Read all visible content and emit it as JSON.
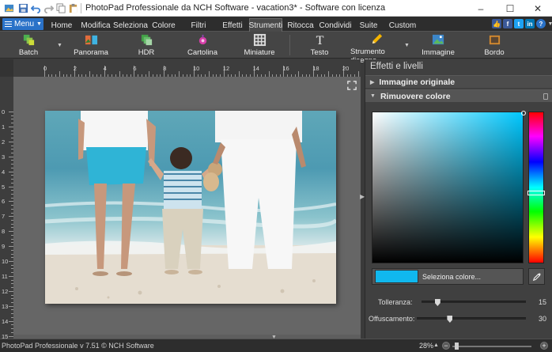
{
  "window": {
    "title": "PhotoPad Professionale da NCH Software - vacation3* - Software con licenza",
    "minimize_glyph": "–",
    "maximize_glyph": "☐",
    "close_glyph": "✕"
  },
  "menu": {
    "label": "Menu"
  },
  "tabs": [
    {
      "label": "Home"
    },
    {
      "label": "Modifica"
    },
    {
      "label": "Seleziona"
    },
    {
      "label": "Colore"
    },
    {
      "label": "Filtri"
    },
    {
      "label": "Effetti"
    },
    {
      "label": "Strumenti",
      "active": true
    },
    {
      "label": "Ritocca"
    },
    {
      "label": "Condividi"
    },
    {
      "label": "Suite"
    },
    {
      "label": "Custom"
    }
  ],
  "toolbar": {
    "batch": "Batch",
    "panorama": "Panorama",
    "hdr": "HDR",
    "cartolina": "Cartolina",
    "miniature": "Miniature",
    "testo": "Testo",
    "strumento_disegno": "Strumento disegno",
    "immagine": "Immagine",
    "bordo": "Bordo"
  },
  "ruler": {
    "top": [
      "0",
      "2",
      "4",
      "6",
      "8",
      "10",
      "12",
      "14",
      "16",
      "18",
      "20"
    ],
    "left": [
      "0",
      "1",
      "2",
      "3",
      "4",
      "5",
      "6",
      "7",
      "8",
      "9",
      "10",
      "11",
      "12",
      "13",
      "14",
      "15"
    ]
  },
  "panel": {
    "title": "Effetti e livelli",
    "section_original": "Immagine originale",
    "section_remove": "Rimuovere colore",
    "select_color_label": "Seleziona colore...",
    "selected_color": "#10b8ee",
    "tolerance_label": "Tolleranza:",
    "tolerance_value": "15",
    "tolerance_fraction": 0.15,
    "blur_label": "Offuscamento:",
    "blur_value": "30",
    "blur_fraction": 0.3
  },
  "status": {
    "text": "PhotoPad Professionale v 7.51 © NCH Software",
    "zoom": "28%"
  },
  "colors": {
    "menu_button": "#2a72c8",
    "selected_color": "#10b8ee"
  }
}
